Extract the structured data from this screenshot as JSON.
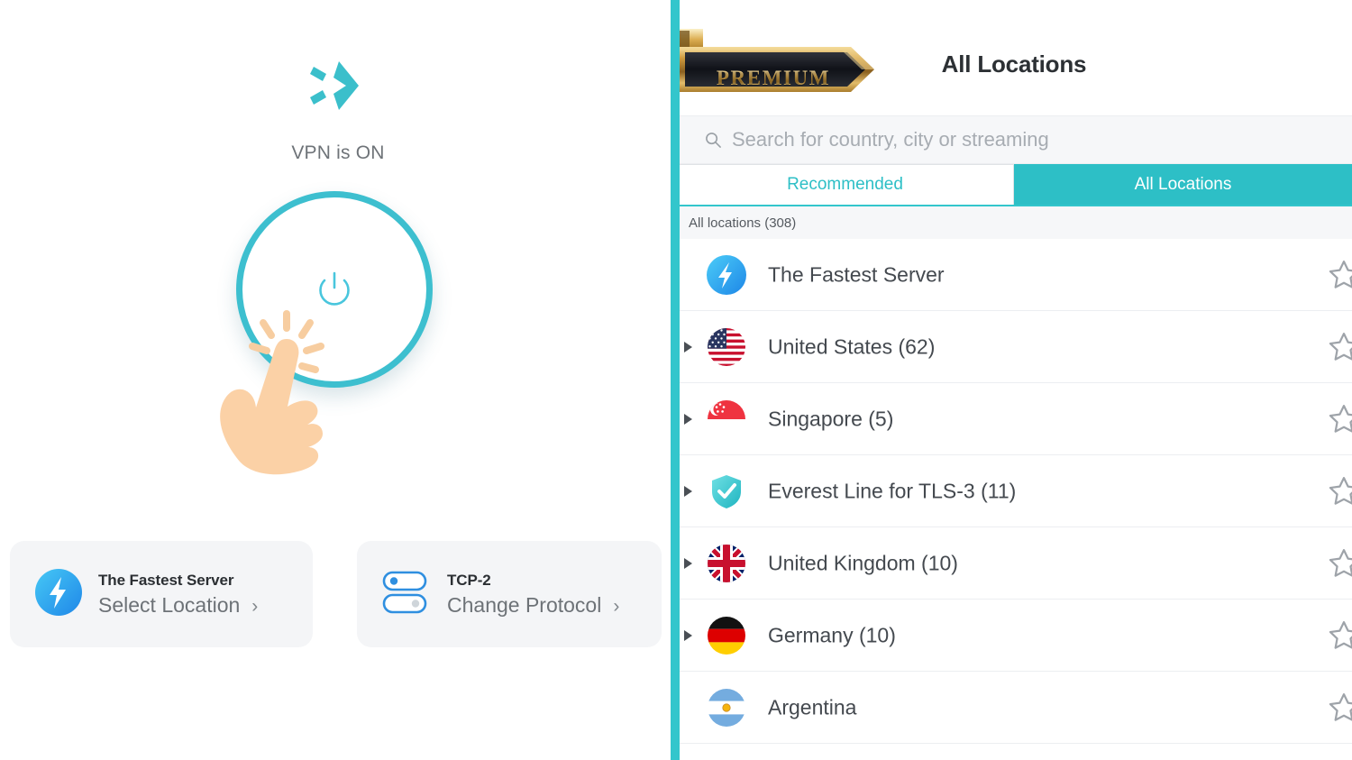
{
  "left": {
    "logo_icon": "x-brand-logo",
    "status_text": "VPN is ON",
    "power_button_icon": "power-icon",
    "tap_hand_icon": "tap-hand-cursor-icon",
    "cards": [
      {
        "icon": "fastest-server-bolt-icon",
        "title": "The Fastest Server",
        "subtitle": "Select Location",
        "chevron": "›"
      },
      {
        "icon": "protocol-toggles-icon",
        "title": "TCP-2",
        "subtitle": "Change Protocol",
        "chevron": "›"
      }
    ]
  },
  "right": {
    "ribbon_label": "PREMIUM",
    "title": "All Locations",
    "search": {
      "icon": "search-icon",
      "placeholder": "Search for country, city or streaming",
      "value": ""
    },
    "tabs": [
      {
        "label": "Recommended",
        "active": false
      },
      {
        "label": "All Locations",
        "active": true
      }
    ],
    "list_header": "All locations (308)",
    "rows": [
      {
        "label": "The Fastest Server",
        "icon": "fastest-server-bolt-icon",
        "expandable": false,
        "star": "star-outline-icon"
      },
      {
        "label": "United States (62)",
        "icon": "flag-us-icon",
        "expandable": true,
        "star": "star-outline-icon"
      },
      {
        "label": "Singapore (5)",
        "icon": "flag-sg-icon",
        "expandable": true,
        "star": "star-outline-icon"
      },
      {
        "label": "Everest Line for TLS-3 (11)",
        "icon": "shield-check-icon",
        "expandable": true,
        "star": "star-outline-icon"
      },
      {
        "label": "United Kingdom (10)",
        "icon": "flag-gb-icon",
        "expandable": true,
        "star": "star-outline-icon"
      },
      {
        "label": "Germany (10)",
        "icon": "flag-de-icon",
        "expandable": true,
        "star": "star-outline-icon"
      },
      {
        "label": "Argentina",
        "icon": "flag-ar-icon",
        "expandable": false,
        "star": "star-outline-icon"
      }
    ]
  },
  "colors": {
    "accent_teal": "#2dbfc6",
    "divider_teal": "#33c6cc",
    "bolt_blue": "#2aa8f2",
    "card_bg": "#f4f5f7",
    "gold": "#e8b85b"
  }
}
